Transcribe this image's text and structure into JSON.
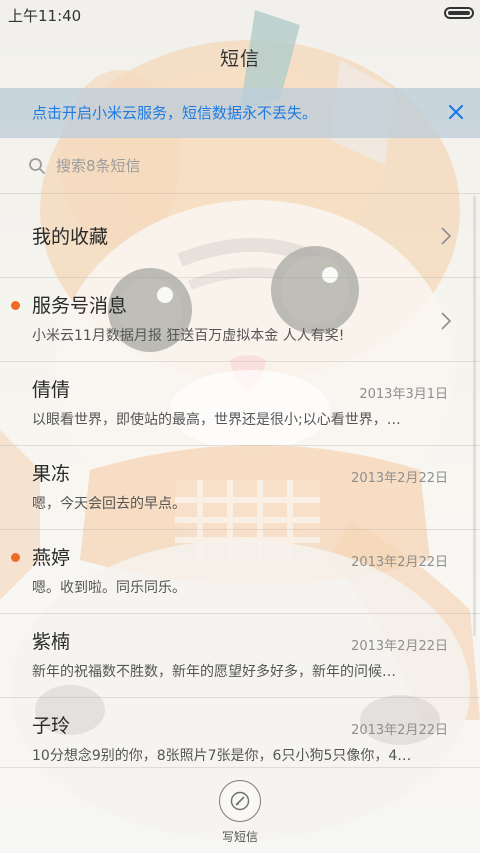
{
  "status_bar": {
    "time": "上午11:40"
  },
  "header": {
    "title": "短信"
  },
  "banner": {
    "text": "点击开启小米云服务，短信数据永不丢失。",
    "accent_color": "#1d7be3"
  },
  "search": {
    "placeholder": "搜索8条短信"
  },
  "favorites": {
    "label": "我的收藏"
  },
  "conversations": [
    {
      "name": "服务号消息",
      "date": "",
      "preview": "小米云11月数据月报 狂送百万虚拟本金 人人有奖!",
      "unread": true,
      "has_chevron": true
    },
    {
      "name": "倩倩",
      "date": "2013年3月1日",
      "preview": "以眼看世界，即使站的最高，世界还是很小;以心看世界，…",
      "unread": false,
      "has_chevron": false
    },
    {
      "name": "果冻",
      "date": "2013年2月22日",
      "preview": "嗯，今天会回去的早点。",
      "unread": false,
      "has_chevron": false
    },
    {
      "name": "燕婷",
      "date": "2013年2月22日",
      "preview": "嗯。收到啦。同乐同乐。",
      "unread": true,
      "has_chevron": false
    },
    {
      "name": "紫楠",
      "date": "2013年2月22日",
      "preview": "新年的祝福数不胜数，新年的愿望好多好多，新年的问候…",
      "unread": false,
      "has_chevron": false
    },
    {
      "name": "子玲",
      "date": "2013年2月22日",
      "preview": "10分想念9别的你，8张照片7张是你，6只小狗5只像你，4…",
      "unread": false,
      "has_chevron": false
    }
  ],
  "compose": {
    "label": "写短信"
  },
  "colors": {
    "unread_dot": "#f06a25"
  }
}
